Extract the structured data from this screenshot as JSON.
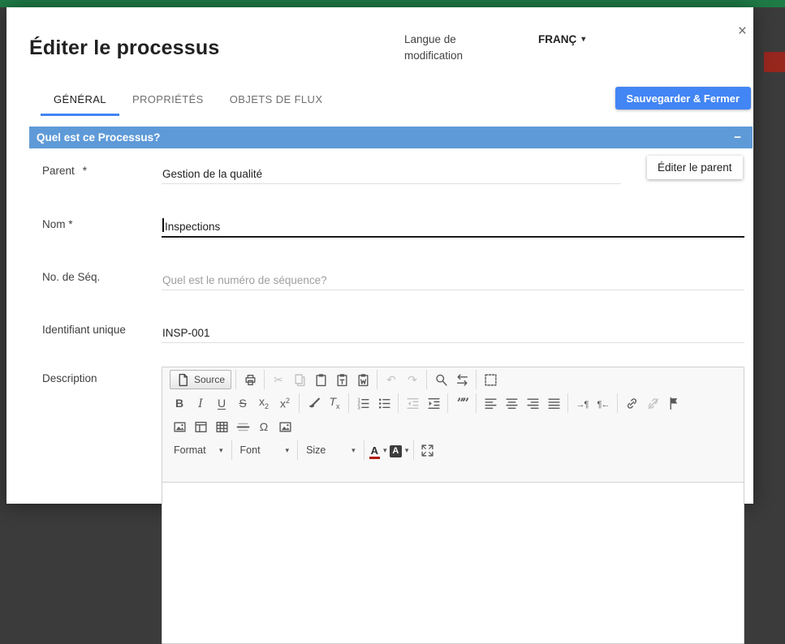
{
  "colors": {
    "header_green": "#1f7b46",
    "primary_blue": "#4285f4",
    "section_bar_blue": "#5e9ad8",
    "background_red_block": "#97271e"
  },
  "modal": {
    "title": "Éditer le processus",
    "close_icon": "×",
    "language": {
      "label": "Langue de modification",
      "value": "FRANÇ",
      "caret": "▾"
    },
    "tabs": [
      {
        "label": "GÉNÉRAL",
        "active": true
      },
      {
        "label": "PROPRIÉTÉS",
        "active": false
      },
      {
        "label": "OBJETS DE FLUX",
        "active": false
      }
    ],
    "save_button": "Sauvegarder & Fermer",
    "section": {
      "title": "Quel est ce Processus?",
      "collapse_icon": "−"
    },
    "fields": {
      "parent": {
        "label": "Parent",
        "required_mark": "*",
        "value": "Gestion de la qualité",
        "edit_button": "Éditer le parent"
      },
      "name": {
        "label": "Nom *",
        "value": "Inspections"
      },
      "sequence": {
        "label": "No. de Séq.",
        "placeholder": "Quel est le numéro de séquence?"
      },
      "unique_id": {
        "label": "Identifiant unique",
        "value": "INSP-001"
      },
      "description": {
        "label": "Description"
      }
    },
    "editor": {
      "toolbar": [
        [
          [
            {
              "name": "source",
              "icon": "doc",
              "label": "Source"
            }
          ],
          [
            {
              "name": "print",
              "icon": "print"
            }
          ],
          [
            {
              "name": "cut",
              "icon": "cut",
              "disabled": true
            },
            {
              "name": "copy",
              "icon": "copy",
              "disabled": true
            },
            {
              "name": "paste",
              "icon": "paste"
            },
            {
              "name": "paste-text",
              "icon": "paste-text"
            },
            {
              "name": "paste-word",
              "icon": "paste-word"
            }
          ],
          [
            {
              "name": "undo",
              "icon": "undo",
              "disabled": true
            },
            {
              "name": "redo",
              "icon": "redo",
              "disabled": true
            }
          ],
          [
            {
              "name": "find",
              "icon": "search"
            },
            {
              "name": "replace",
              "icon": "replace"
            }
          ],
          [
            {
              "name": "select-all",
              "icon": "select-all"
            }
          ]
        ],
        [
          [
            {
              "name": "bold",
              "icon": "bold"
            },
            {
              "name": "italic",
              "icon": "italic"
            },
            {
              "name": "underline",
              "icon": "underline"
            },
            {
              "name": "strikethrough",
              "icon": "strike"
            },
            {
              "name": "subscript",
              "icon": "subscript"
            },
            {
              "name": "superscript",
              "icon": "superscript"
            }
          ],
          [
            {
              "name": "copy-formatting",
              "icon": "brush"
            },
            {
              "name": "remove-format",
              "icon": "remove-format"
            }
          ],
          [
            {
              "name": "numbered-list",
              "icon": "list-ol"
            },
            {
              "name": "bulleted-list",
              "icon": "list-ul"
            }
          ],
          [
            {
              "name": "decrease-indent",
              "icon": "outdent",
              "disabled": true
            },
            {
              "name": "increase-indent",
              "icon": "indent"
            }
          ],
          [
            {
              "name": "blockquote",
              "icon": "quote"
            }
          ],
          [
            {
              "name": "align-left",
              "icon": "align-left"
            },
            {
              "name": "align-center",
              "icon": "align-center"
            },
            {
              "name": "align-right",
              "icon": "align-right"
            },
            {
              "name": "align-justify",
              "icon": "align-justify"
            }
          ],
          [
            {
              "name": "text-direction-ltr",
              "icon": "ltr"
            },
            {
              "name": "text-direction-rtl",
              "icon": "rtl"
            }
          ],
          [
            {
              "name": "link",
              "icon": "link"
            },
            {
              "name": "unlink",
              "icon": "unlink",
              "disabled": true
            },
            {
              "name": "anchor",
              "icon": "flag"
            }
          ]
        ],
        [
          [
            {
              "name": "insert-image",
              "icon": "image"
            },
            {
              "name": "insert-template",
              "icon": "template"
            },
            {
              "name": "insert-table",
              "icon": "table"
            },
            {
              "name": "horizontal-rule",
              "icon": "hr"
            },
            {
              "name": "special-character",
              "icon": "omega"
            },
            {
              "name": "insert-media",
              "icon": "image"
            }
          ]
        ],
        [
          [
            {
              "name": "paragraph-format",
              "dropdown": "Format"
            }
          ],
          [
            {
              "name": "font",
              "dropdown": "Font"
            }
          ],
          [
            {
              "name": "size",
              "dropdown": "Size"
            }
          ],
          [
            {
              "name": "text-color",
              "icon": "text-color",
              "caret": true
            },
            {
              "name": "background-color",
              "icon": "bg-color",
              "caret": true
            }
          ],
          [
            {
              "name": "maximize",
              "icon": "maximize"
            }
          ]
        ]
      ]
    }
  }
}
